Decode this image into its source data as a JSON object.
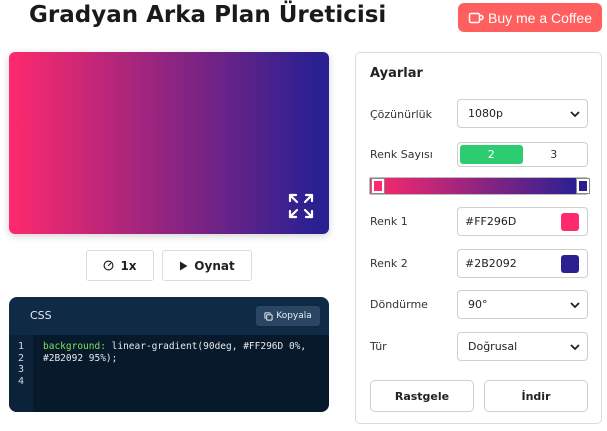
{
  "header": {
    "title": "Gradyan Arka Plan Üreticisi",
    "coffee_label": "Buy me a Coffee"
  },
  "preview": {
    "gradient_css": "linear-gradient(90deg, #FF296D 0%, #2B2092 95%)",
    "fullscreen_icon": "expand-arrows-icon"
  },
  "controls": {
    "speed_label": "1x",
    "speed_icon": "gauge-icon",
    "play_label": "Oynat",
    "play_icon": "play-icon"
  },
  "css_panel": {
    "label": "CSS",
    "copy_label": "Kopyala",
    "copy_icon": "copy-icon",
    "line_numbers": [
      "1",
      "2",
      "3",
      "4"
    ],
    "code_property": "background:",
    "code_value_line1": " linear-gradient(90deg, #FF296D 0%,",
    "code_value_line2": "#2B2092 95%);"
  },
  "settings": {
    "title": "Ayarlar",
    "resolution_label": "Çözünürlük",
    "resolution_value": "1080p",
    "color_count_label": "Renk Sayısı",
    "color_count_options": [
      "2",
      "3"
    ],
    "color_count_selected": "2",
    "color1_label": "Renk 1",
    "color1_value": "#FF296D",
    "color2_label": "Renk 2",
    "color2_value": "#2B2092",
    "rotation_label": "Döndürme",
    "rotation_value": "90°",
    "type_label": "Tür",
    "type_value": "Doğrusal",
    "random_label": "Rastgele",
    "download_label": "İndir"
  },
  "colors": {
    "accent_green": "#2ecc71",
    "coffee_red": "#ff5f5f",
    "code_bg": "#0f2a44"
  }
}
